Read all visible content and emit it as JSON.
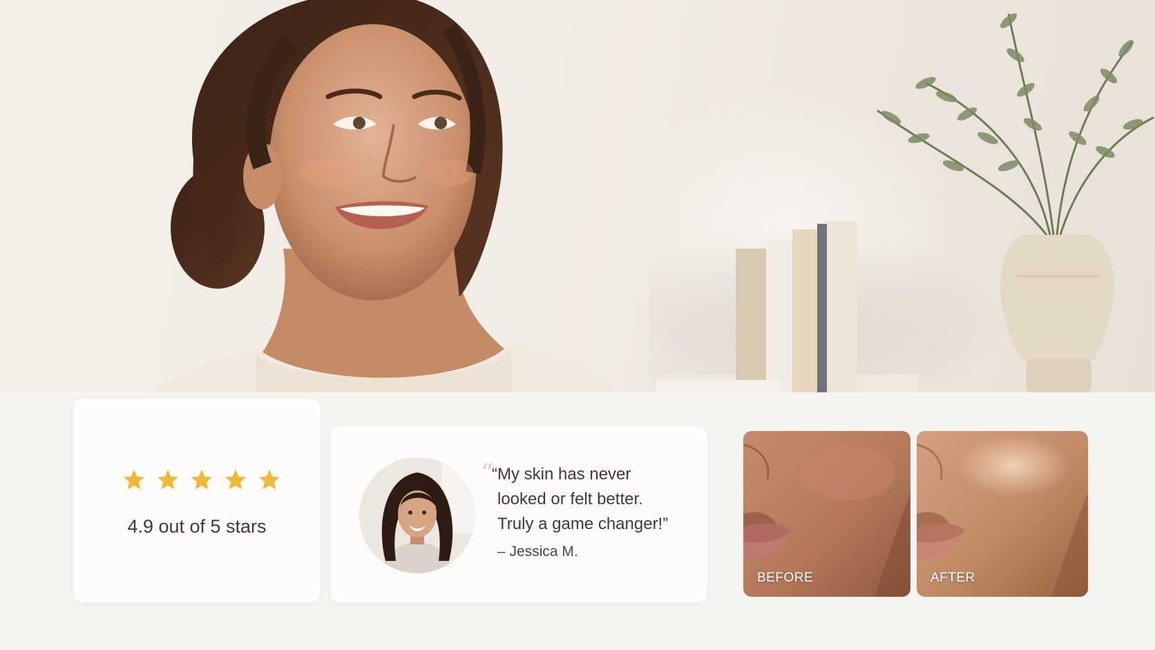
{
  "rating": {
    "stars": 5,
    "star_color": "#f2b936",
    "text": "4.9 out of 5 stars"
  },
  "testimonial": {
    "quote_line1": "“My skin has never",
    "quote_line2": "looked or felt better.",
    "quote_line3": "Truly a game changer!”",
    "author": "– Jessica M.",
    "quote_icon": "quote-mark-icon"
  },
  "comparison": {
    "before_label": "BEFORE",
    "after_label": "AFTER"
  },
  "colors": {
    "background": "#f6f4f1",
    "card": "#fdfcfb",
    "text": "#3e3a37"
  }
}
